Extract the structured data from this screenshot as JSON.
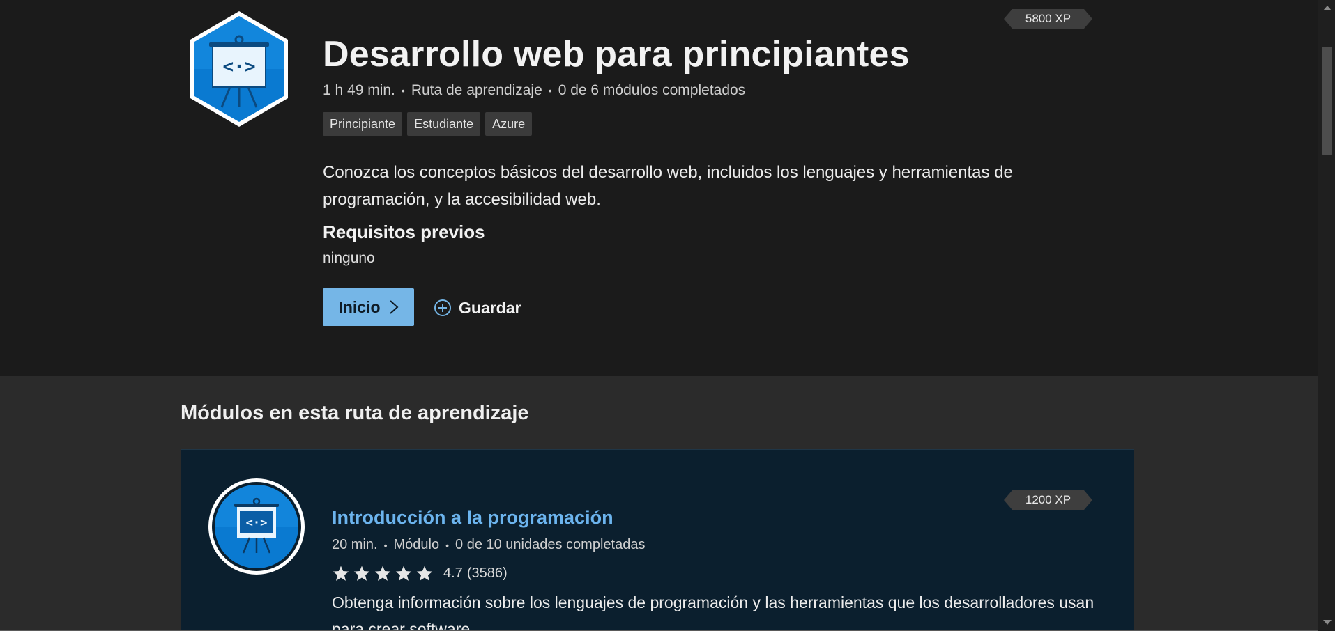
{
  "hero": {
    "title": "Desarrollo web para principiantes",
    "duration": "1 h 49 min.",
    "type": "Ruta de aprendizaje",
    "progress": "0 de 6 módulos completados",
    "xp": "5800 XP",
    "tags": [
      "Principiante",
      "Estudiante",
      "Azure"
    ],
    "description": "Conozca los conceptos básicos del desarrollo web, incluidos los lenguajes y herramientas de programación, y la accesibilidad web.",
    "prerequisites_title": "Requisitos previos",
    "prerequisites_value": "ninguno",
    "start_label": "Inicio",
    "save_label": "Guardar",
    "icon": "presentation-code-icon"
  },
  "modules_section": {
    "title": "Módulos en esta ruta de aprendizaje",
    "items": [
      {
        "title": "Introducción a la programación",
        "duration": "20 min.",
        "type": "Módulo",
        "progress": "0 de 10 unidades completadas",
        "rating": "4.7",
        "rating_count": "(3586)",
        "stars": 5,
        "xp": "1200 XP",
        "description": "Obtenga información sobre los lenguajes de programación y las herramientas que los desarrolladores usan para crear software.",
        "icon": "presentation-code-icon"
      }
    ]
  },
  "colors": {
    "accent": "#75b6e7",
    "link": "#6cb4ee",
    "hero_bg": "#1b1b1b",
    "section_bg": "#2b2b2b",
    "card_bg": "#0b1f2e"
  }
}
